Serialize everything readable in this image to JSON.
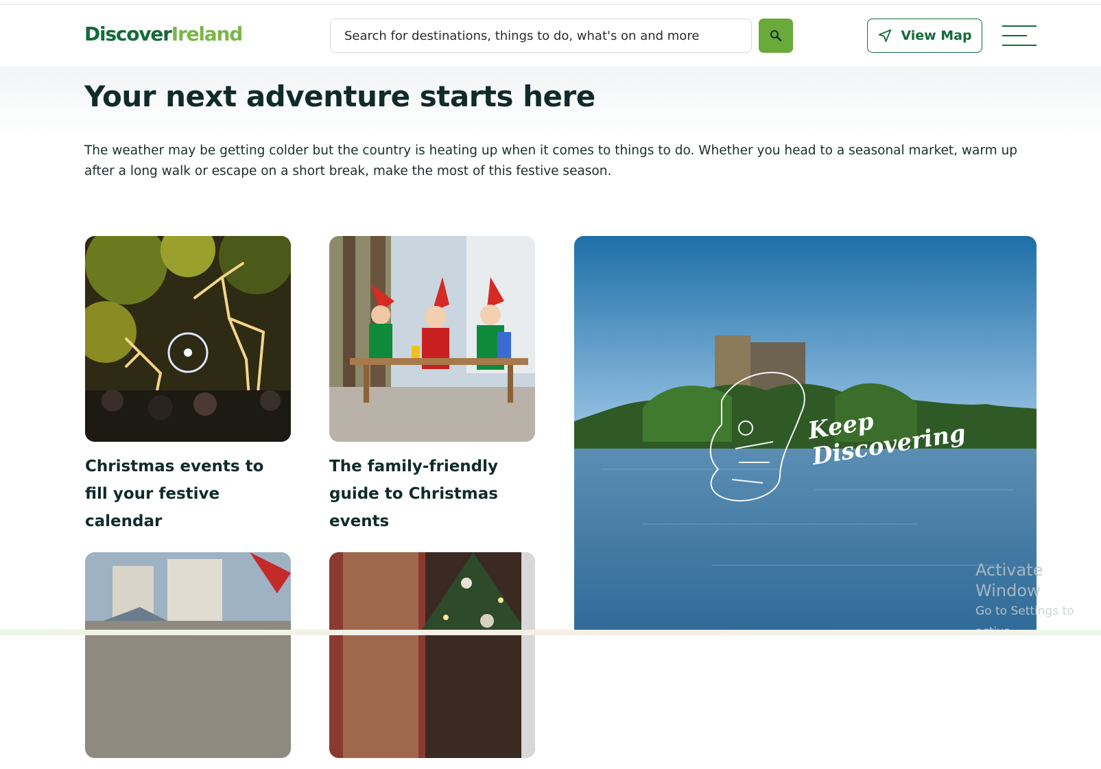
{
  "header": {
    "logo_part1": "Discover",
    "logo_part2": "Ireland",
    "search_placeholder": "Search for destinations, things to do, what's on and more",
    "search_icon": "search-icon",
    "view_map_label": "View Map",
    "view_map_icon": "navigation-arrow-icon",
    "menu_icon": "hamburger-menu-icon"
  },
  "hero": {
    "title": "Your next adventure starts here",
    "intro": "The weather may be getting colder but the country is heating up when it comes to things to do. Whether you head to a seasonal market, warm up after a long walk or escape on a short break, make the most of this festive season."
  },
  "cards": [
    {
      "title": "Christmas events to fill your festive calendar"
    },
    {
      "title": "The family-friendly guide to Christmas events"
    },
    {
      "title": ""
    },
    {
      "title": ""
    }
  ],
  "feature": {
    "overlay_text_line1": "Keep",
    "overlay_text_line2": "Discovering"
  },
  "os_watermark": {
    "line1": "Activate Window",
    "line2": "Go to Settings to activa"
  },
  "colors": {
    "brand_dark_green": "#136a3a",
    "brand_light_green": "#7ab648",
    "search_button": "#6aaa3a",
    "heading": "#0f2b2a"
  }
}
